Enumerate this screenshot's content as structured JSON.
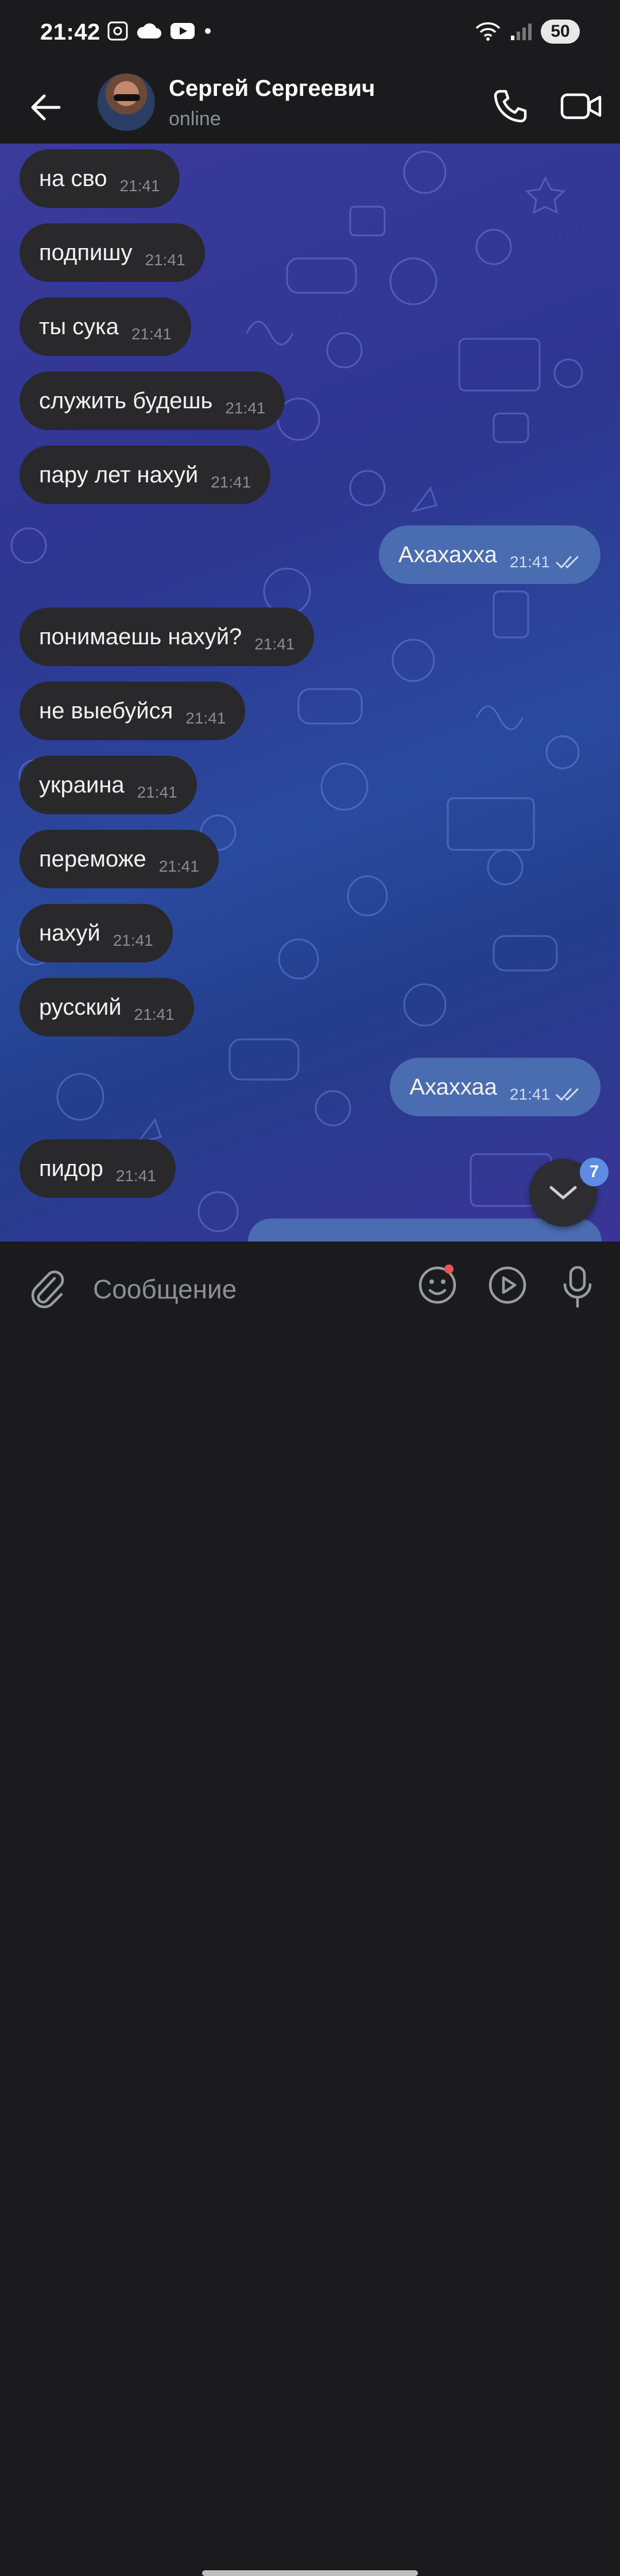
{
  "status_bar": {
    "time": "21:42",
    "battery": "50"
  },
  "header": {
    "name": "Сергей Сергеевич",
    "status": "online"
  },
  "messages": [
    {
      "dir": "in",
      "text": "на сво",
      "time": "21:41"
    },
    {
      "dir": "in",
      "text": "подпишу",
      "time": "21:41"
    },
    {
      "dir": "in",
      "text": "ты сука",
      "time": "21:41"
    },
    {
      "dir": "in",
      "text": "служить будешь",
      "time": "21:41"
    },
    {
      "dir": "in",
      "text": "пару лет нахуй",
      "time": "21:41"
    },
    {
      "dir": "out",
      "text": "Ахахахха",
      "time": "21:41"
    },
    {
      "dir": "in",
      "text": "понимаешь нахуй?",
      "time": "21:41"
    },
    {
      "dir": "in",
      "text": "не выебуйся",
      "time": "21:41"
    },
    {
      "dir": "in",
      "text": "украина",
      "time": "21:41"
    },
    {
      "dir": "in",
      "text": "переможе",
      "time": "21:41"
    },
    {
      "dir": "in",
      "text": "нахуй",
      "time": "21:41"
    },
    {
      "dir": "in",
      "text": "русский",
      "time": "21:41"
    },
    {
      "dir": "out",
      "text": "Ахаххаа",
      "time": "21:41"
    },
    {
      "dir": "in",
      "text": "пидор",
      "time": "21:41"
    }
  ],
  "scroll": {
    "unread_count": "7"
  },
  "composer": {
    "placeholder": "Сообщение"
  },
  "colors": {
    "incoming_bubble": "#29292c",
    "outgoing_bubble": "#4a6cb0",
    "unread_badge": "#5d8be6"
  },
  "icons": [
    "camera-icon",
    "cloud-icon",
    "youtube-icon",
    "wifi-icon",
    "signal-icon",
    "back-arrow-icon",
    "phone-icon",
    "video-camera-icon",
    "chevron-down-icon",
    "paperclip-icon",
    "emoji-icon",
    "play-icon",
    "microphone-icon"
  ]
}
